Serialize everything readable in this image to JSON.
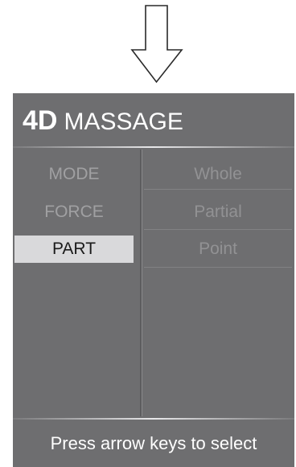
{
  "indicator": {
    "icon": "down-arrow-icon"
  },
  "header": {
    "title_bold": "4D",
    "title_rest": "MASSAGE"
  },
  "menu": {
    "items": [
      {
        "label": "MODE",
        "selected": false
      },
      {
        "label": "FORCE",
        "selected": false
      },
      {
        "label": "PART",
        "selected": true
      }
    ]
  },
  "options": {
    "items": [
      {
        "label": "Whole"
      },
      {
        "label": "Partial"
      },
      {
        "label": "Point"
      }
    ]
  },
  "footer": {
    "hint": "Press arrow keys to select"
  },
  "colors": {
    "panel_bg": "#6e6e70",
    "selected_bg": "#d9d9db",
    "title_text": "#ffffff"
  }
}
